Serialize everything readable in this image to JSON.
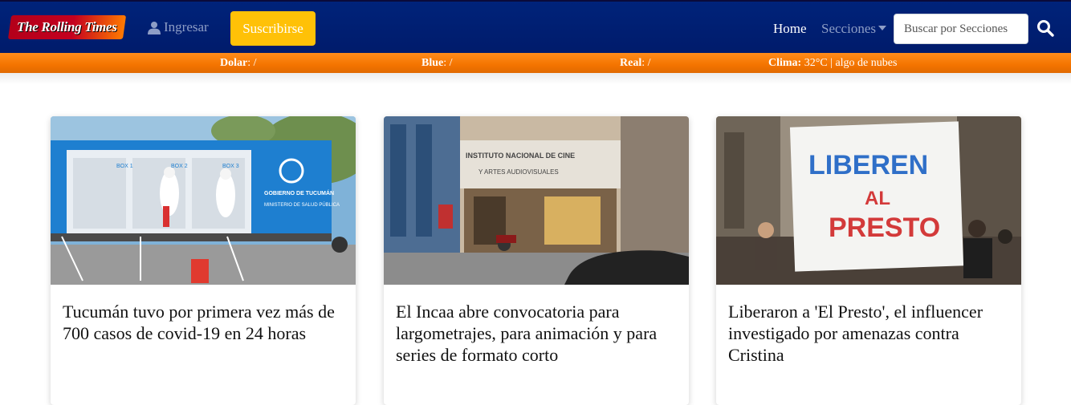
{
  "header": {
    "logo_text": "The Rolling Times",
    "login_label": "Ingresar",
    "subscribe_label": "Suscribirse",
    "nav_home": "Home",
    "nav_sections": "Secciones",
    "search_placeholder": "Buscar por Secciones"
  },
  "ticker": {
    "dolar_label": "Dolar",
    "dolar_value": ": /",
    "blue_label": "Blue",
    "blue_value": ": /",
    "real_label": "Real",
    "real_value": ": /",
    "clima_label": "Clima:",
    "clima_value": " 32°C | algo de nubes"
  },
  "cards": [
    {
      "title": "Tucumán tuvo por primera vez más de 700 casos de covid-19 en 24 horas",
      "image_sign_1": "GOBIERNO DE TUCUMÁN",
      "image_sign_2": "MINISTERIO DE SALUD PÚBLICA",
      "box_labels": [
        "BOX 1",
        "BOX 2",
        "BOX 3"
      ]
    },
    {
      "title": "El Incaa abre convocatoria para largometrajes, para animación y para series de formato corto",
      "image_sign_1": "INSTITUTO NACIONAL DE CINE",
      "image_sign_2": "Y ARTES AUDIOVISUALES"
    },
    {
      "title": "Liberaron a 'El Presto', el influencer investigado por amenazas contra Cristina",
      "image_sign_1": "LIBEREN",
      "image_sign_2": "AL",
      "image_sign_3": "PRESTO"
    }
  ],
  "colors": {
    "navbar": "#001f70",
    "ticker": "#f47400",
    "subscribe": "#ffc107"
  }
}
